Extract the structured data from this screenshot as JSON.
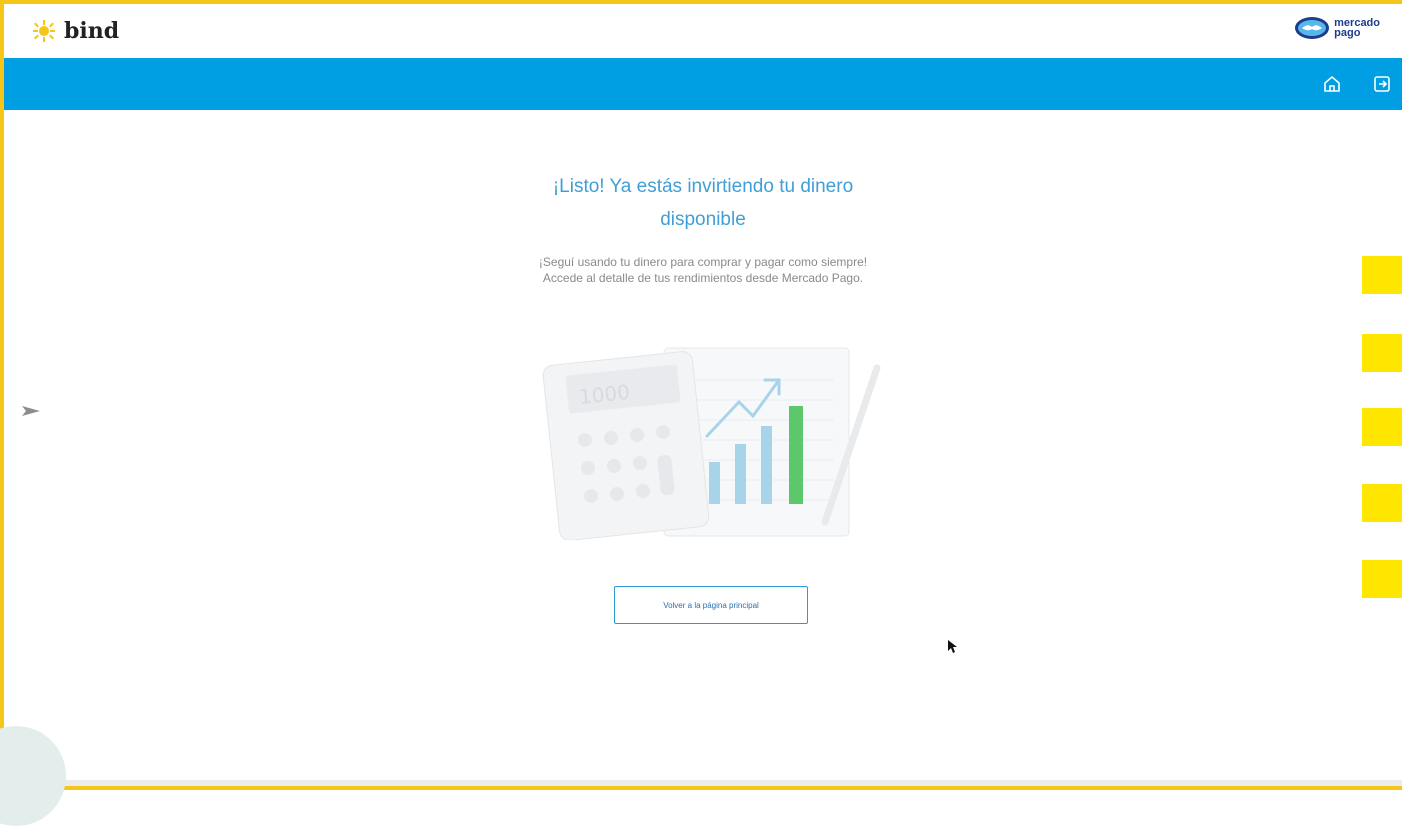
{
  "header": {
    "brand": "bind",
    "partner_line1": "mercado",
    "partner_line2": "pago",
    "home_icon": "home-icon",
    "logout_icon": "logout-icon"
  },
  "main": {
    "title_line1": "¡Listo! Ya estás invirtiendo tu dinero",
    "title_line2": "disponible",
    "subtitle_line1": "¡Seguí usando tu dinero para comprar y pagar como siempre!",
    "subtitle_line2": "Accede al detalle de tus rendimientos desde Mercado Pago.",
    "calculator_display": "1000",
    "button_label": "Volver a la página principal"
  },
  "colors": {
    "accent": "#009ee3",
    "title": "#3f9fd6",
    "frame": "#f5c518",
    "swatch": "#ffe600",
    "bar_green": "#5cc76b",
    "bar_blue": "#a8d4ea"
  }
}
